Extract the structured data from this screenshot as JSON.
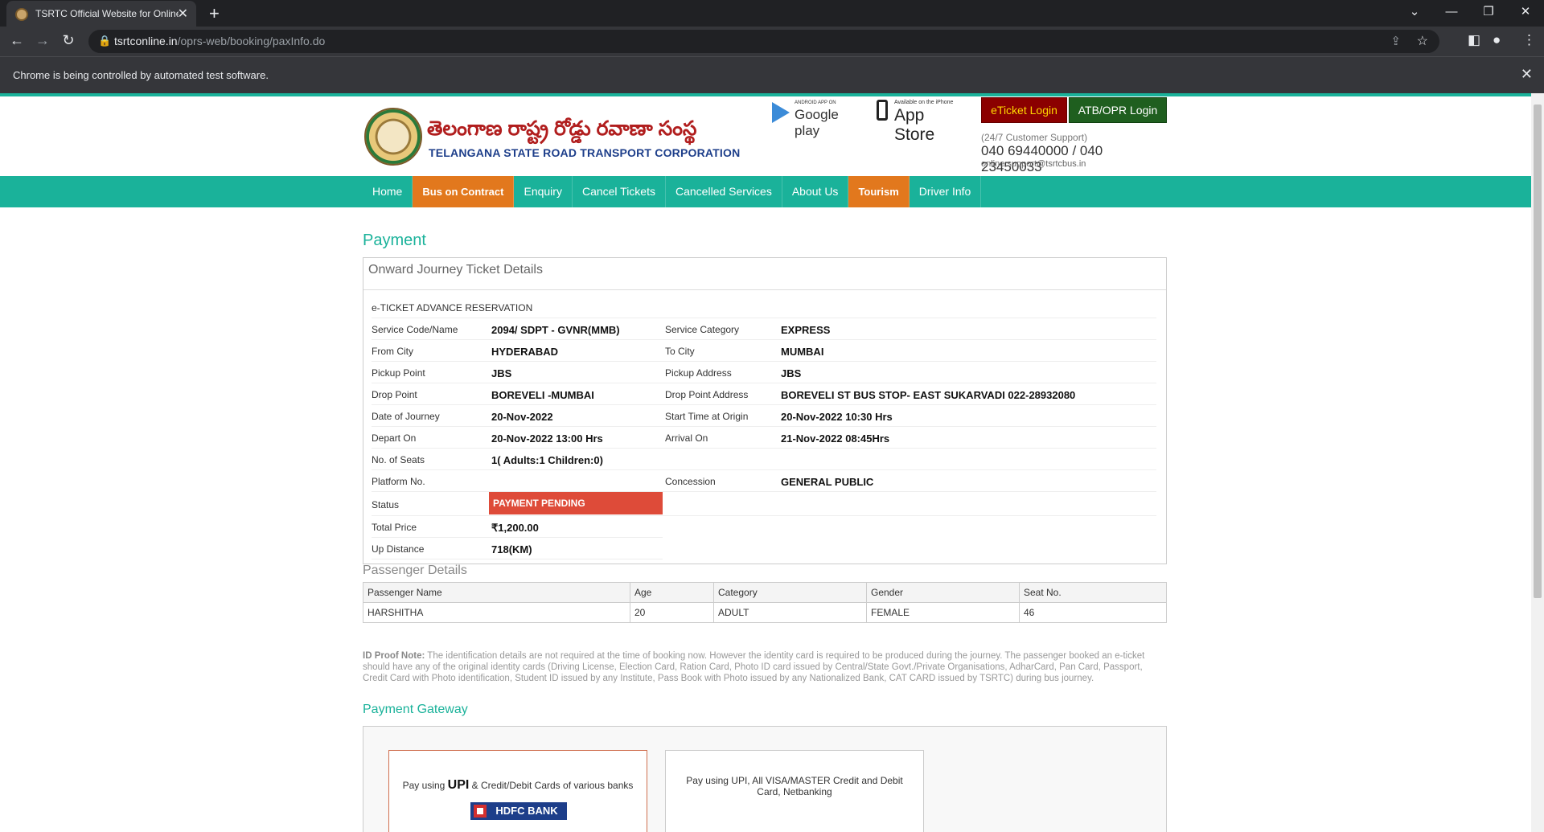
{
  "browser": {
    "tab_title": "TSRTC Official Website for Online",
    "url_host": "tsrtconline.in",
    "url_path": "/oprs-web/booking/paxInfo.do",
    "infobar_message": "Chrome is being controlled by automated test software."
  },
  "header": {
    "logo_telugu": "తెలంగాణ రాష్ట్ర రోడ్డు రవాణా సంస్థ",
    "logo_english": "TELANGANA STATE ROAD TRANSPORT CORPORATION",
    "google_play_small": "ANDROID APP ON",
    "google_play_large": "Google play",
    "app_store_small": "Available on the iPhone",
    "app_store_large": "App Store",
    "eticket_login": "eTicket Login",
    "atb_login": "ATB/OPR Login",
    "support_label": "(24/7 Customer Support)",
    "phones": "040 69440000 / 040 23450033",
    "email": "online.support@tsrtcbus.in"
  },
  "nav": {
    "items": [
      {
        "label": "Home",
        "highlight": false
      },
      {
        "label": "Bus on Contract",
        "highlight": true
      },
      {
        "label": "Enquiry",
        "highlight": false
      },
      {
        "label": "Cancel Tickets",
        "highlight": false
      },
      {
        "label": "Cancelled Services",
        "highlight": false
      },
      {
        "label": "About Us",
        "highlight": false
      },
      {
        "label": "Tourism",
        "highlight": true
      },
      {
        "label": "Driver Info",
        "highlight": false
      }
    ]
  },
  "payment": {
    "title": "Payment",
    "ticket_heading": "Onward Journey Ticket Details",
    "reservation_type": "e-TICKET ADVANCE RESERVATION",
    "rows": [
      {
        "l1": "Service Code/Name",
        "v1": "2094/ SDPT - GVNR(MMB)",
        "l2": "Service Category",
        "v2": "EXPRESS"
      },
      {
        "l1": "From City",
        "v1": "HYDERABAD",
        "l2": "To City",
        "v2": "MUMBAI"
      },
      {
        "l1": "Pickup Point",
        "v1": "JBS",
        "l2": "Pickup Address",
        "v2": "JBS"
      },
      {
        "l1": "Drop Point",
        "v1": "BOREVELI -MUMBAI",
        "l2": "Drop Point Address",
        "v2": "BOREVELI ST BUS STOP- EAST SUKARVADI 022-28932080"
      },
      {
        "l1": "Date of Journey",
        "v1": "20-Nov-2022",
        "l2": "Start Time at Origin",
        "v2": "20-Nov-2022 10:30 Hrs"
      },
      {
        "l1": "Depart On",
        "v1": "20-Nov-2022  13:00 Hrs",
        "l2": "Arrival On",
        "v2": "21-Nov-2022  08:45Hrs"
      },
      {
        "l1": "No. of Seats",
        "v1": "1( Adults:1  Children:0)",
        "l2": "",
        "v2": ""
      },
      {
        "l1": "Platform No.",
        "v1": "",
        "l2": "Concession",
        "v2": "GENERAL PUBLIC"
      }
    ],
    "status_label": "Status",
    "status_value": "PAYMENT PENDING",
    "total_price_label": "Total Price",
    "total_price_value": "₹1,200.00",
    "up_distance_label": "Up Distance",
    "up_distance_value": "718(KM)"
  },
  "passengers": {
    "title": "Passenger Details",
    "columns": [
      "Passenger Name",
      "Age",
      "Category",
      "Gender",
      "Seat No."
    ],
    "rows": [
      [
        "HARSHITHA",
        "20",
        "ADULT",
        "FEMALE",
        "46"
      ]
    ]
  },
  "id_note": {
    "label": "ID Proof Note:",
    "text": " The identification details are not required at the time of booking now. However the identity card is required to be produced during the journey. The passenger booked an e-ticket should have any of the original identity cards (Driving License, Election Card, Ration Card, Photo ID card issued by Central/State Govt./Private Organisations, AdharCard, Pan Card, Passport, Credit Card with Photo identification, Student ID issued by any Institute, Pass Book with Photo issued by any Nationalized Bank, CAT CARD issued by TSRTC) during bus journey."
  },
  "gateway": {
    "title": "Payment Gateway",
    "option1_prefix": "Pay using ",
    "option1_upi": "UPI",
    "option1_suffix": " & Credit/Debit Cards of various banks",
    "option1_bank": "HDFC BANK",
    "option2_text": "Pay using UPI, All VISA/MASTER Credit and Debit Card, Netbanking"
  }
}
